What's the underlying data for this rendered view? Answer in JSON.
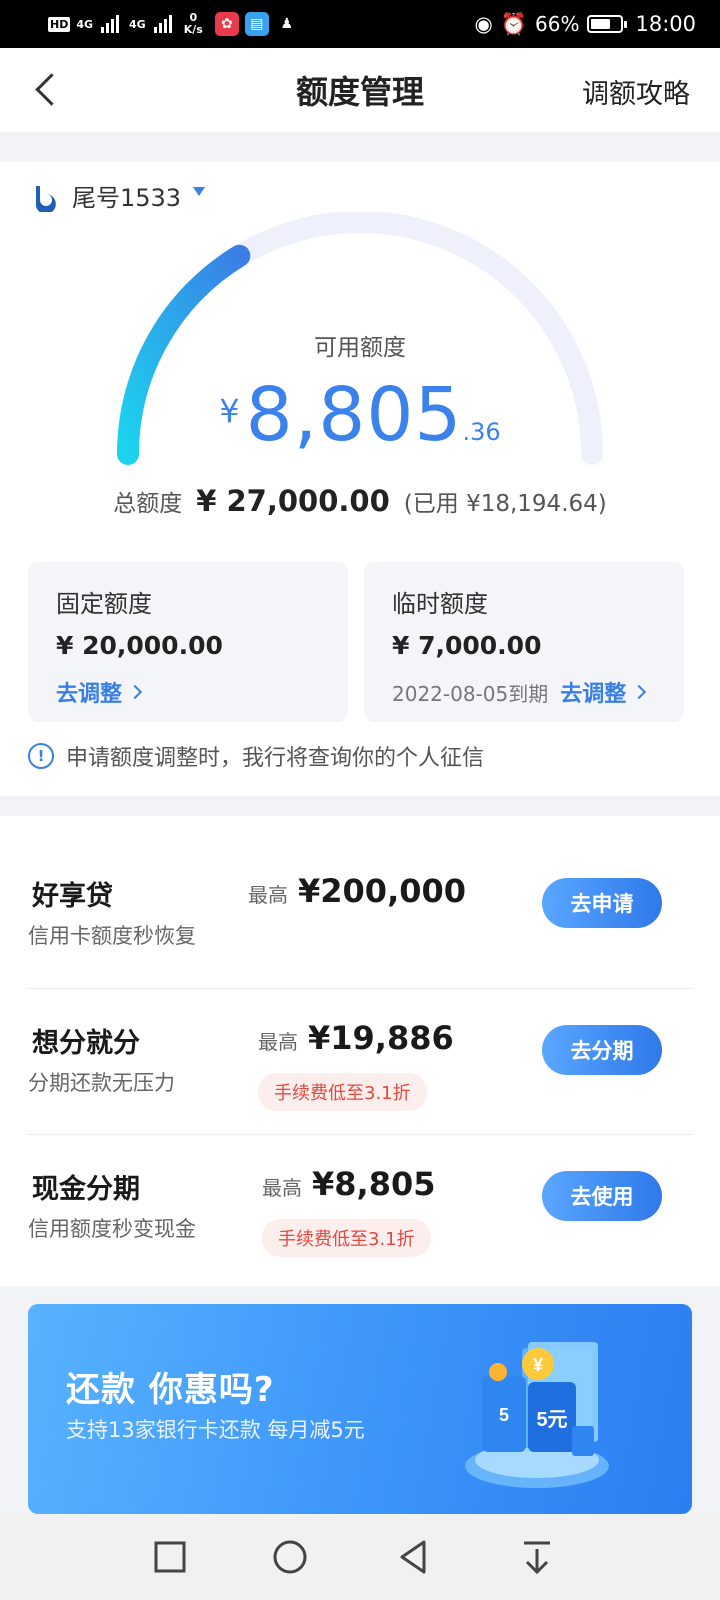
{
  "status_bar": {
    "hd": "HD",
    "network1": "4G",
    "network2": "4G",
    "speed_value": "0",
    "speed_unit": "K/s",
    "battery_percent": "66%",
    "battery_level": 0.66,
    "time": "18:00"
  },
  "header": {
    "title": "额度管理",
    "action": "调额攻略"
  },
  "card": {
    "account_label": "尾号1533",
    "available_label": "可用额度",
    "available_currency": "¥",
    "available_int": "8,805",
    "available_dec": ".36",
    "available_ratio": 0.326,
    "total_label": "总额度",
    "total_amount": "¥ 27,000.00",
    "used_text": "(已用 ¥18,194.64)",
    "fixed": {
      "title": "固定额度",
      "amount": "¥ 20,000.00",
      "link": "去调整"
    },
    "temporary": {
      "title": "临时额度",
      "amount": "¥ 7,000.00",
      "expiry": "2022-08-05到期",
      "link": "去调整"
    },
    "notice": "申请额度调整时，我行将查询你的个人征信"
  },
  "products": [
    {
      "name": "好享贷",
      "desc": "信用卡额度秒恢复",
      "max_label": "最高",
      "max_value": "¥200,000",
      "fee": "",
      "button": "去申请"
    },
    {
      "name": "想分就分",
      "desc": "分期还款无压力",
      "max_label": "最高",
      "max_value": "¥19,886",
      "fee": "手续费低至3.1折",
      "button": "去分期"
    },
    {
      "name": "现金分期",
      "desc": "信用额度秒变现金",
      "max_label": "最高",
      "max_value": "¥8,805",
      "fee": "手续费低至3.1折",
      "button": "去使用"
    }
  ],
  "banner": {
    "title": "还款 你惠吗?",
    "subtitle": "支持13家银行卡还款 每月减5元",
    "art_text_1": "5元",
    "art_text_2": "5",
    "art_text_3": "¥"
  },
  "colors": {
    "accent": "#3a7fe6",
    "amount_blue": "#3c82ec",
    "fee_red": "#e2483d"
  }
}
